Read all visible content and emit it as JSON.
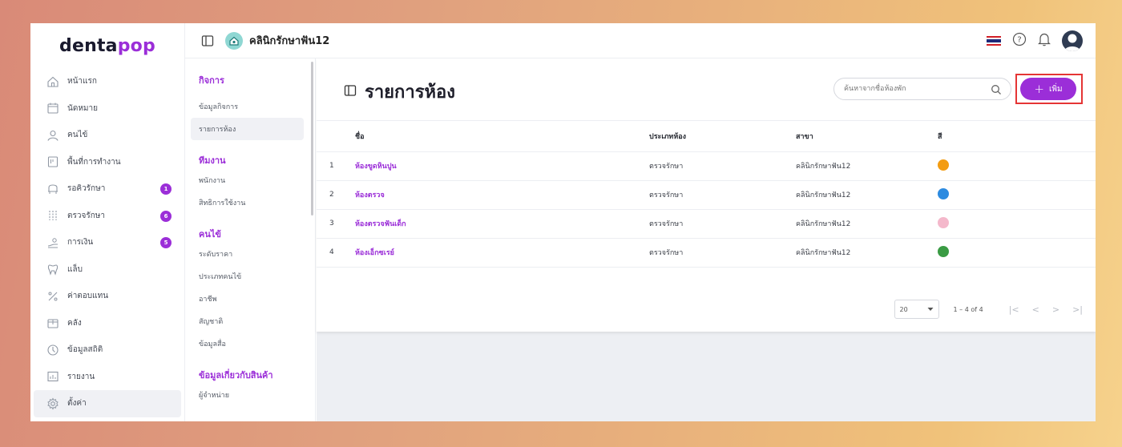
{
  "brand": {
    "logo_prefix": "denta",
    "logo_accent": "pop"
  },
  "sidebar": {
    "items": [
      {
        "label": "หน้าแรก",
        "icon": "home-icon"
      },
      {
        "label": "นัดหมาย",
        "icon": "calendar-icon"
      },
      {
        "label": "คนไข้",
        "icon": "user-icon"
      },
      {
        "label": "พื้นที่การทำงาน",
        "icon": "workspace-icon"
      },
      {
        "label": "รอคิวรักษา",
        "icon": "dental-chair-icon",
        "badge": "1"
      },
      {
        "label": "ตรวจรักษา",
        "icon": "treatment-icon",
        "badge": "6"
      },
      {
        "label": "การเงิน",
        "icon": "payment-icon",
        "badge": "5"
      },
      {
        "label": "แล็บ",
        "icon": "tooth-icon"
      },
      {
        "label": "ค่าตอบแทน",
        "icon": "percent-icon"
      },
      {
        "label": "คลัง",
        "icon": "box-icon"
      },
      {
        "label": "ข้อมูลสถิติ",
        "icon": "stats-icon"
      },
      {
        "label": "รายงาน",
        "icon": "chart-icon"
      },
      {
        "label": "ตั้งค่า",
        "icon": "gear-icon"
      }
    ]
  },
  "topbar": {
    "clinic_name": "คลินิกรักษาฟัน12"
  },
  "subnav": {
    "sections": [
      {
        "title": "กิจการ",
        "items": [
          "ข้อมูลกิจการ",
          "รายการห้อง"
        ]
      },
      {
        "title": "ทีมงาน",
        "items": [
          "พนักงาน",
          "สิทธิการใช้งาน"
        ]
      },
      {
        "title": "คนไข้",
        "items": [
          "ระดับราคา",
          "ประเภทคนไข้",
          "อาชีพ",
          "สัญชาติ",
          "ข้อมูลสื่อ"
        ]
      },
      {
        "title": "ข้อมูลเกี่ยวกับสินค้า",
        "items": [
          "ผู้จำหน่าย"
        ]
      }
    ]
  },
  "page": {
    "title": "รายการห้อง",
    "search_placeholder": "ค้นหาจากชื่อห้องพัก",
    "add_label": "เพิ่ม"
  },
  "table": {
    "headers": [
      "ชื่อ",
      "ประเภทห้อง",
      "สาขา",
      "สี"
    ],
    "rows": [
      {
        "no": "1",
        "name": "ห้องขูดหินปูน",
        "type": "ตรวจรักษา",
        "branch": "คลินิกรักษาฟัน12",
        "color": "#f39c12"
      },
      {
        "no": "2",
        "name": "ห้องตรวจ",
        "type": "ตรวจรักษา",
        "branch": "คลินิกรักษาฟัน12",
        "color": "#2d8be0"
      },
      {
        "no": "3",
        "name": "ห้องตรวจฟันเด็ก",
        "type": "ตรวจรักษา",
        "branch": "คลินิกรักษาฟัน12",
        "color": "#f4b8cb"
      },
      {
        "no": "4",
        "name": "ห้องเอ็กซเรย์",
        "type": "ตรวจรักษา",
        "branch": "คลินิกรักษาฟัน12",
        "color": "#3a9b44"
      }
    ]
  },
  "pagination": {
    "per_page": "20",
    "range": "1 – 4 of 4"
  },
  "colors": {
    "accent": "#9b2ed8",
    "highlight_border": "#e53535"
  }
}
